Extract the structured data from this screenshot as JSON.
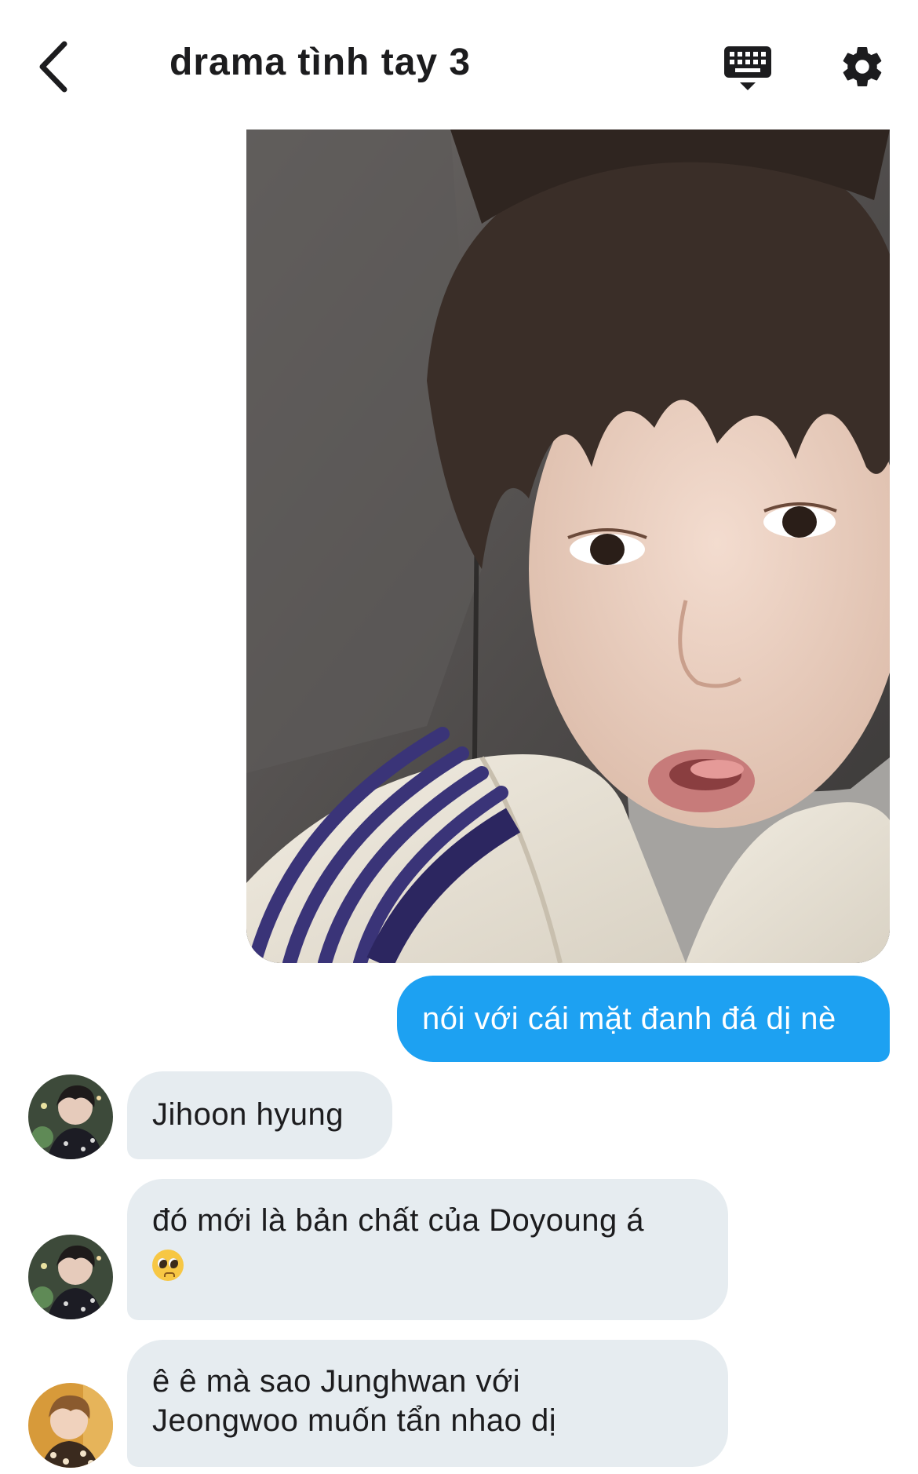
{
  "header": {
    "title": "drama tình tay 3",
    "back_icon": "chevron-left-icon",
    "keyboard_icon": "keyboard-icon",
    "settings_icon": "gear-icon"
  },
  "messages": [
    {
      "type": "image",
      "direction": "outgoing"
    },
    {
      "type": "text",
      "direction": "outgoing",
      "text": "nói với cái mặt đanh đá dị nè"
    },
    {
      "type": "text",
      "direction": "incoming",
      "avatar": "avatar-1",
      "text": "Jihoon hyung"
    },
    {
      "type": "text",
      "direction": "incoming",
      "avatar": "avatar-1",
      "text_line1": "đó mới là bản chất của Doyoung á",
      "emoji": "pleading-face-emoji"
    },
    {
      "type": "text",
      "direction": "incoming",
      "avatar": "avatar-2",
      "text_line1": "ê ê mà sao Junghwan với",
      "text_line2": "Jeongwoo muốn tẩn nhao dị"
    }
  ],
  "colors": {
    "outgoing_bubble": "#1da1f2",
    "incoming_bubble": "#e6ecf0",
    "text": "#1c1c1e"
  }
}
